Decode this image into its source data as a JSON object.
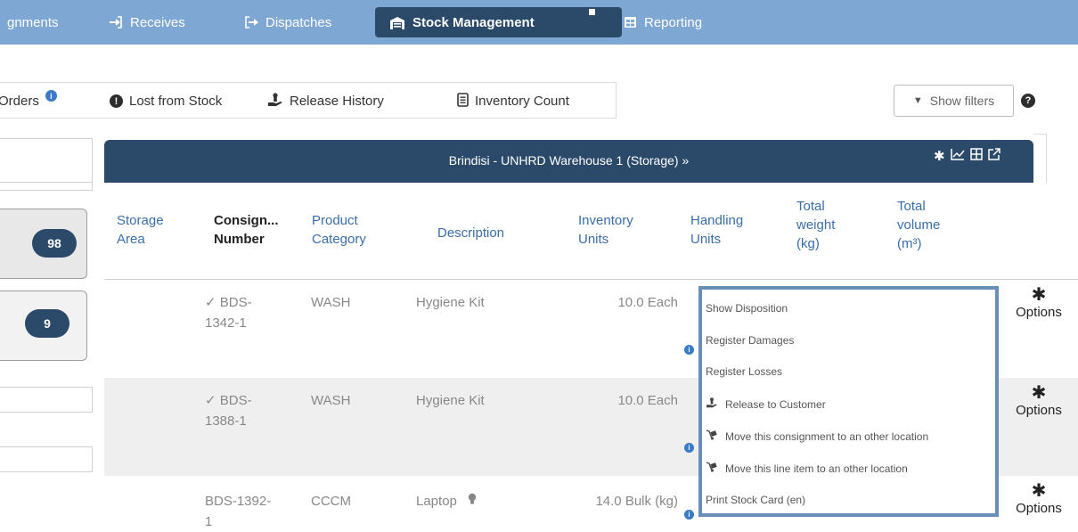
{
  "topnav": {
    "items": [
      {
        "label": "gnments",
        "icon": ""
      },
      {
        "label": "Receives",
        "icon": "sign-in-icon"
      },
      {
        "label": "Dispatches",
        "icon": "sign-out-icon"
      },
      {
        "label": "Stock Management",
        "icon": "warehouse-icon"
      },
      {
        "label": "Reporting",
        "icon": "table-icon"
      }
    ]
  },
  "subtabs": [
    {
      "label": "Orders",
      "icon": "info-badge"
    },
    {
      "label": "Lost from Stock",
      "icon": "exclamation-icon"
    },
    {
      "label": "Release History",
      "icon": "hand-icon"
    },
    {
      "label": "Inventory Count",
      "icon": "list-icon"
    }
  ],
  "filters": {
    "label": "Show filters"
  },
  "left_panel": {
    "counts": [
      "98",
      "9"
    ]
  },
  "warehouse": {
    "title": "Brindisi - UNHRD Warehouse 1 (Storage) »"
  },
  "table": {
    "headers": [
      {
        "lines": [
          "Storage",
          "Area"
        ]
      },
      {
        "lines": [
          "Consign...",
          "Number"
        ]
      },
      {
        "lines": [
          "Product",
          "Category"
        ]
      },
      {
        "lines": [
          "Description"
        ]
      },
      {
        "lines": [
          "Inventory",
          "Units"
        ]
      },
      {
        "lines": [
          "Handling",
          "Units"
        ]
      },
      {
        "lines": [
          "Total",
          "weight",
          "(kg)"
        ]
      },
      {
        "lines": [
          "Total",
          "volume",
          "(m³)"
        ]
      }
    ],
    "rows": [
      {
        "consignment": [
          "✓ BDS-",
          "1342-1"
        ],
        "category": "WASH",
        "description": "Hygiene Kit",
        "units": "10.0 Each"
      },
      {
        "consignment": [
          "✓ BDS-",
          "1388-1"
        ],
        "category": "WASH",
        "description": "Hygiene Kit",
        "units": "10.0 Each"
      },
      {
        "consignment": [
          "BDS-1392-",
          "1"
        ],
        "category": "CCCM",
        "description": "Laptop",
        "units": "14.0 Bulk (kg)"
      }
    ],
    "options_label": "Options"
  },
  "menu": {
    "items": [
      {
        "label": "Show Disposition",
        "icon": ""
      },
      {
        "label": "Register Damages",
        "icon": ""
      },
      {
        "label": "Register Losses",
        "icon": ""
      },
      {
        "label": "Release to Customer",
        "icon": "hand-icon"
      },
      {
        "label": "Move this consignment to an other location",
        "icon": "dolly-icon"
      },
      {
        "label": "Move this line item to an other location",
        "icon": "dolly-icon"
      },
      {
        "label": "Print Stock Card (en)",
        "icon": ""
      }
    ]
  },
  "colors": {
    "nav": "#7fa7d3",
    "navy": "#2b4a6a",
    "link": "#3a6ea8",
    "menu_border": "#6a8fb6"
  }
}
